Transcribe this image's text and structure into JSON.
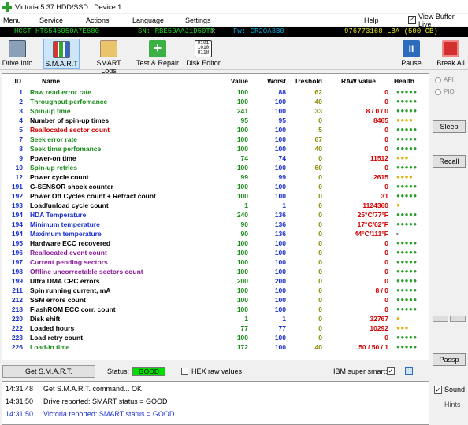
{
  "window": {
    "title": "Victoria 5.37 HDD/SSD | Device 1"
  },
  "menu": {
    "items": [
      "Menu",
      "Service",
      "Actions",
      "Language",
      "Settings",
      "Help"
    ],
    "view_buffer_label": "View Buffer Live",
    "view_buffer_checked": "✓"
  },
  "device": {
    "model": "HGST HTS545050A7E680",
    "serial": "SN: RBE50AAJ1D50TP",
    "close": "x",
    "fw": "Fw: GR2OA3B0",
    "lba": "976773168 LBA (500 GB)"
  },
  "toolbar": {
    "drive_info": "Drive Info",
    "smart": "S.M.A.R.T",
    "smart_logs": "SMART Logs",
    "test_repair": "Test & Repair",
    "disk_editor": "Disk Editor",
    "pause": "Pause",
    "break_all": "Break All"
  },
  "columns": {
    "id": "ID",
    "name": "Name",
    "value": "Value",
    "worst": "Worst",
    "treshold": "Treshold",
    "raw": "RAW value",
    "health": "Health"
  },
  "colors": {
    "green": "#1a8a1a",
    "red": "#d40000",
    "blue": "#1a2fd0",
    "purple": "#8a1a9a",
    "black": "#000000",
    "dot_green": "#2aa02a",
    "dot_yellow": "#e0b000"
  },
  "rows": [
    {
      "id": "1",
      "name": "Raw read error rate",
      "value": "100",
      "worst": "88",
      "thr": "62",
      "raw": "0",
      "health": "●●●●●",
      "nc": "green",
      "rc": "red",
      "hc": "green"
    },
    {
      "id": "2",
      "name": "Throughput perfomance",
      "value": "100",
      "worst": "100",
      "thr": "40",
      "raw": "0",
      "health": "●●●●●",
      "nc": "green",
      "rc": "red",
      "hc": "green"
    },
    {
      "id": "3",
      "name": "Spin-up time",
      "value": "241",
      "worst": "100",
      "thr": "33",
      "raw": "8 / 0 / 0",
      "health": "●●●●●",
      "nc": "green",
      "rc": "red",
      "hc": "green"
    },
    {
      "id": "4",
      "name": "Number of spin-up times",
      "value": "95",
      "worst": "95",
      "thr": "0",
      "raw": "8465",
      "health": "●●●●",
      "nc": "black",
      "rc": "red",
      "hc": "yellow"
    },
    {
      "id": "5",
      "name": "Reallocated sector count",
      "value": "100",
      "worst": "100",
      "thr": "5",
      "raw": "0",
      "health": "●●●●●",
      "nc": "red",
      "rc": "red",
      "hc": "green"
    },
    {
      "id": "7",
      "name": "Seek error rate",
      "value": "100",
      "worst": "100",
      "thr": "67",
      "raw": "0",
      "health": "●●●●●",
      "nc": "green",
      "rc": "red",
      "hc": "green"
    },
    {
      "id": "8",
      "name": "Seek time perfomance",
      "value": "100",
      "worst": "100",
      "thr": "40",
      "raw": "0",
      "health": "●●●●●",
      "nc": "green",
      "rc": "red",
      "hc": "green"
    },
    {
      "id": "9",
      "name": "Power-on time",
      "value": "74",
      "worst": "74",
      "thr": "0",
      "raw": "11512",
      "health": "●●●",
      "nc": "black",
      "rc": "red",
      "hc": "yellow"
    },
    {
      "id": "10",
      "name": "Spin-up retries",
      "value": "100",
      "worst": "100",
      "thr": "60",
      "raw": "0",
      "health": "●●●●●",
      "nc": "green",
      "rc": "red",
      "hc": "green"
    },
    {
      "id": "12",
      "name": "Power cycle count",
      "value": "99",
      "worst": "99",
      "thr": "0",
      "raw": "2615",
      "health": "●●●●",
      "nc": "black",
      "rc": "red",
      "hc": "yellow"
    },
    {
      "id": "191",
      "name": "G-SENSOR shock counter",
      "value": "100",
      "worst": "100",
      "thr": "0",
      "raw": "0",
      "health": "●●●●●",
      "nc": "black",
      "rc": "red",
      "hc": "green"
    },
    {
      "id": "192",
      "name": "Power Off Cycles count + Retract count",
      "value": "100",
      "worst": "100",
      "thr": "0",
      "raw": "31",
      "health": "●●●●●",
      "nc": "black",
      "rc": "red",
      "hc": "green"
    },
    {
      "id": "193",
      "name": "Load/unload cycle count",
      "value": "1",
      "worst": "1",
      "thr": "0",
      "raw": "1124360",
      "health": "●",
      "nc": "black",
      "rc": "red",
      "hc": "yellow"
    },
    {
      "id": "194",
      "name": "HDA Temperature",
      "value": "240",
      "worst": "136",
      "thr": "0",
      "raw": "25°C/77°F",
      "health": "●●●●●",
      "nc": "blue",
      "rc": "red",
      "hc": "green"
    },
    {
      "id": "194",
      "name": "Minimum temperature",
      "value": "90",
      "worst": "136",
      "thr": "0",
      "raw": "17°C/62°F",
      "health": "●●●●●",
      "nc": "blue",
      "rc": "red",
      "hc": "green"
    },
    {
      "id": "194",
      "name": "Maximum temperature",
      "value": "90",
      "worst": "136",
      "thr": "0",
      "raw": "44°C/111°F",
      "health": "-",
      "nc": "blue",
      "rc": "red",
      "hc": "black"
    },
    {
      "id": "195",
      "name": "Hardware ECC recovered",
      "value": "100",
      "worst": "100",
      "thr": "0",
      "raw": "0",
      "health": "●●●●●",
      "nc": "black",
      "rc": "red",
      "hc": "green"
    },
    {
      "id": "196",
      "name": "Reallocated event count",
      "value": "100",
      "worst": "100",
      "thr": "0",
      "raw": "0",
      "health": "●●●●●",
      "nc": "purple",
      "rc": "red",
      "hc": "green"
    },
    {
      "id": "197",
      "name": "Current pending sectors",
      "value": "100",
      "worst": "100",
      "thr": "0",
      "raw": "0",
      "health": "●●●●●",
      "nc": "purple",
      "rc": "red",
      "hc": "green"
    },
    {
      "id": "198",
      "name": "Offline uncorrectable sectors count",
      "value": "100",
      "worst": "100",
      "thr": "0",
      "raw": "0",
      "health": "●●●●●",
      "nc": "purple",
      "rc": "red",
      "hc": "green"
    },
    {
      "id": "199",
      "name": "Ultra DMA CRC errors",
      "value": "200",
      "worst": "200",
      "thr": "0",
      "raw": "0",
      "health": "●●●●●",
      "nc": "black",
      "rc": "red",
      "hc": "green"
    },
    {
      "id": "211",
      "name": "Spin running current, mA",
      "value": "100",
      "worst": "100",
      "thr": "0",
      "raw": "8 / 0",
      "health": "●●●●●",
      "nc": "black",
      "rc": "red",
      "hc": "green"
    },
    {
      "id": "212",
      "name": "SSM errors count",
      "value": "100",
      "worst": "100",
      "thr": "0",
      "raw": "0",
      "health": "●●●●●",
      "nc": "black",
      "rc": "red",
      "hc": "green"
    },
    {
      "id": "218",
      "name": "FlashROM ECC corr. count",
      "value": "100",
      "worst": "100",
      "thr": "0",
      "raw": "0",
      "health": "●●●●●",
      "nc": "black",
      "rc": "red",
      "hc": "green"
    },
    {
      "id": "220",
      "name": "Disk shift",
      "value": "1",
      "worst": "1",
      "thr": "0",
      "raw": "32767",
      "health": "●",
      "nc": "black",
      "rc": "red",
      "hc": "yellow"
    },
    {
      "id": "222",
      "name": "Loaded hours",
      "value": "77",
      "worst": "77",
      "thr": "0",
      "raw": "10292",
      "health": "●●●",
      "nc": "black",
      "rc": "red",
      "hc": "yellow"
    },
    {
      "id": "223",
      "name": "Load retry count",
      "value": "100",
      "worst": "100",
      "thr": "0",
      "raw": "0",
      "health": "●●●●●",
      "nc": "black",
      "rc": "red",
      "hc": "green"
    },
    {
      "id": "226",
      "name": "Load-in time",
      "value": "172",
      "worst": "100",
      "thr": "40",
      "raw": "50 / 50 / 1",
      "health": "●●●●●",
      "nc": "green",
      "rc": "red",
      "hc": "green"
    }
  ],
  "side": {
    "api": "API",
    "pio": "PIO",
    "sleep": "Sleep",
    "recall": "Recall",
    "passp": "Passp"
  },
  "status": {
    "get_smart": "Get S.M.A.R.T.",
    "status_label": "Status:",
    "status_value": "GOOD",
    "hex_raw": "HEX raw values",
    "ibm": "IBM super smart:",
    "ibm_checked": "✓"
  },
  "log": [
    {
      "time": "14:31:48",
      "msg": "Get S.M.A.R.T. command... OK",
      "color": "#000000"
    },
    {
      "time": "14:31:50",
      "msg": "Drive reported: SMART status = GOOD",
      "color": "#000000"
    },
    {
      "time": "14:31:50",
      "msg": "Victoria reported: SMART status = GOOD",
      "color": "#1a2fd0"
    }
  ],
  "sound": {
    "label": "Sound",
    "checked": "✓",
    "hints": "Hints"
  }
}
